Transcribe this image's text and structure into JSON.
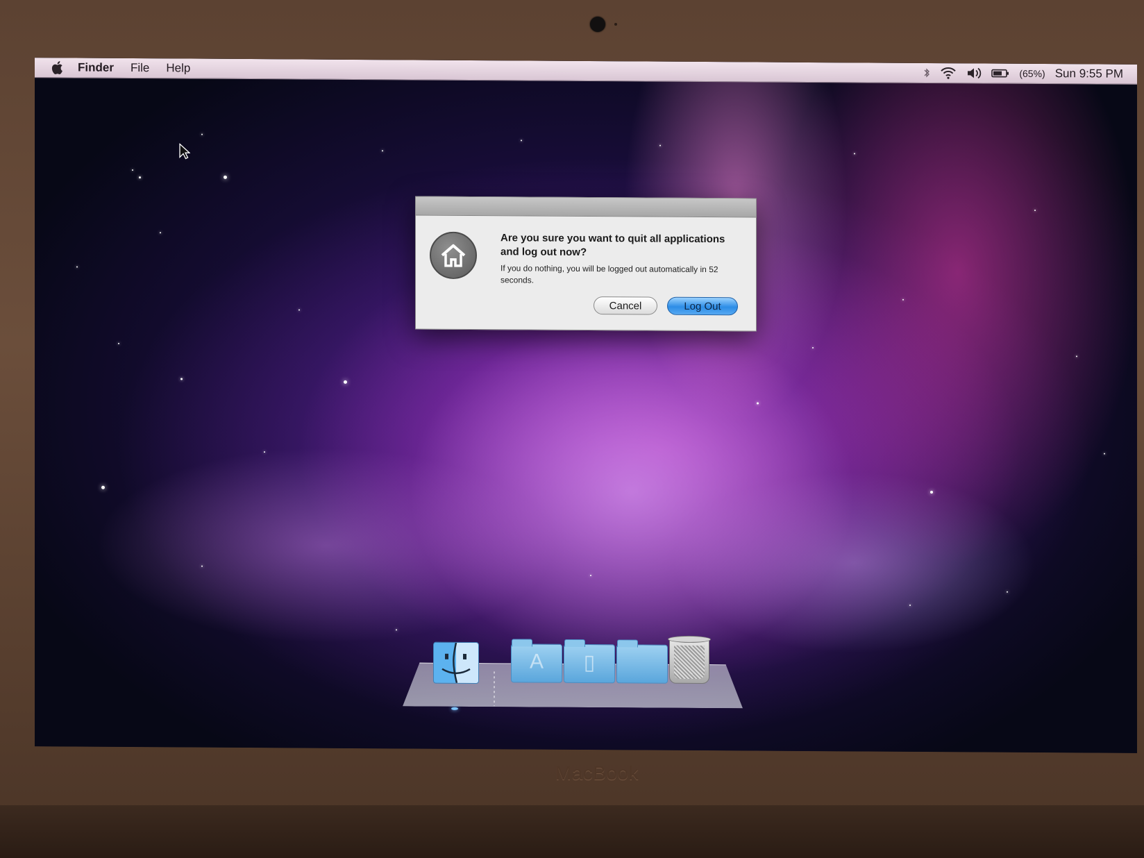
{
  "menubar": {
    "app_name": "Finder",
    "items": [
      "File",
      "Help"
    ],
    "battery": "(65%)",
    "clock": "Sun 9:55 PM"
  },
  "dialog": {
    "title": "Are you sure you want to quit all applications and log out now?",
    "message": "If you do nothing, you will be logged out automatically in 52 seconds.",
    "cancel_label": "Cancel",
    "logout_label": "Log Out"
  },
  "dock": {
    "items": [
      "finder-icon",
      "applications-folder-icon",
      "documents-folder-icon",
      "downloads-folder-icon",
      "trash-icon"
    ]
  },
  "device": {
    "brand": "MacBook"
  },
  "colors": {
    "accent_button": "#2d8de6",
    "menubar": "#e6d5e0"
  }
}
